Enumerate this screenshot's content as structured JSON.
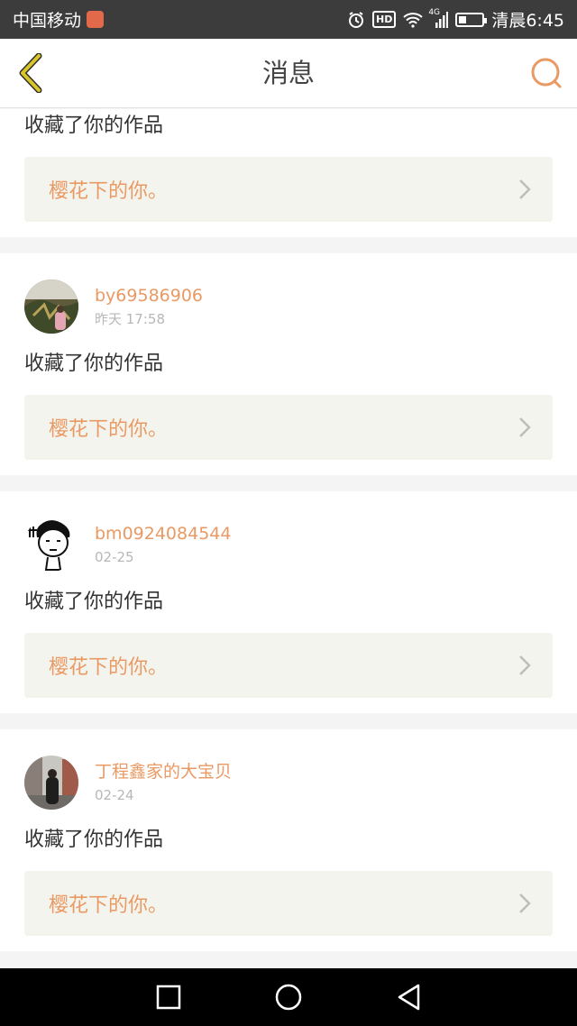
{
  "status_bar": {
    "carrier": "中国移动",
    "network": "4G",
    "hd": "HD",
    "time_label": "清晨6:45",
    "battery_level": 0.3
  },
  "header": {
    "title": "消息",
    "back_icon": "chevron-left-icon",
    "search_icon": "search-icon"
  },
  "messages": [
    {
      "action": "收藏了你的作品",
      "work_title": "樱花下的你。"
    },
    {
      "username": "by69586906",
      "time": "昨天 17:58",
      "action": "收藏了你的作品",
      "work_title": "樱花下的你。"
    },
    {
      "username": "bm0924084544",
      "time": "02-25",
      "action": "收藏了你的作品",
      "work_title": "樱花下的你。"
    },
    {
      "username": "丁程鑫家的大宝贝",
      "time": "02-24",
      "action": "收藏了你的作品",
      "work_title": "樱花下的你。"
    }
  ],
  "colors": {
    "accent": "#e99a64",
    "back_arrow": "#c9b21c",
    "work_box_bg": "#f4f4ee"
  }
}
